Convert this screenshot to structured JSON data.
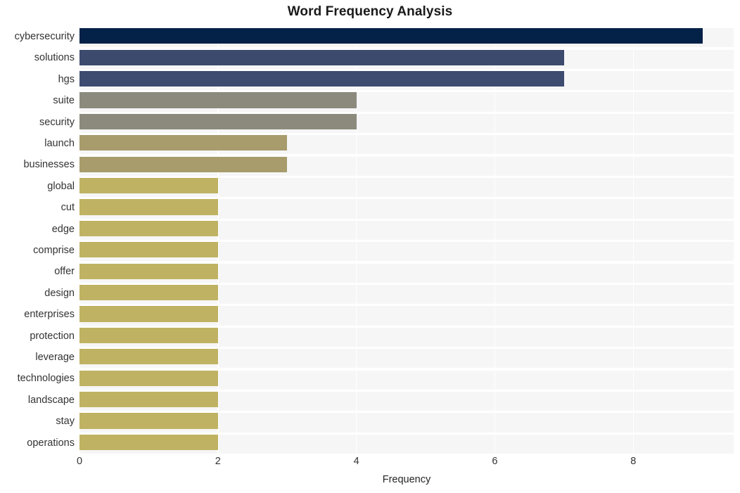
{
  "chart_data": {
    "type": "bar",
    "orientation": "horizontal",
    "title": "Word Frequency Analysis",
    "xlabel": "Frequency",
    "ylabel": "",
    "xlim": [
      0,
      9.45
    ],
    "xticks": [
      0,
      2,
      4,
      6,
      8
    ],
    "xtick_labels": [
      "0",
      "2",
      "4",
      "6",
      "8"
    ],
    "grid": "vertical-and-horizontal-white-on-light-background",
    "legend": "none",
    "categories": [
      "cybersecurity",
      "solutions",
      "hgs",
      "suite",
      "security",
      "launch",
      "businesses",
      "global",
      "cut",
      "edge",
      "comprise",
      "offer",
      "design",
      "enterprises",
      "protection",
      "leverage",
      "technologies",
      "landscape",
      "stay",
      "operations"
    ],
    "values": [
      9,
      7,
      7,
      4,
      4,
      3,
      3,
      2,
      2,
      2,
      2,
      2,
      2,
      2,
      2,
      2,
      2,
      2,
      2,
      2
    ],
    "bar_colors": [
      "#042147",
      "#3c4a6e",
      "#3d4b70",
      "#8c8a7d",
      "#8b8a7c",
      "#a89c6c",
      "#a89c6c",
      "#bfb263",
      "#bfb263",
      "#bfb263",
      "#bfb263",
      "#bfb263",
      "#bfb263",
      "#bfb263",
      "#bfb263",
      "#bfb263",
      "#bfb263",
      "#bfb263",
      "#bfb263",
      "#bfb263"
    ]
  },
  "style": {
    "figure_background": "#ffffff",
    "axes_background": "#f6f6f7",
    "gridline_color": "#ffffff",
    "text_color": "#333333",
    "title_color": "#1a1a1a"
  }
}
